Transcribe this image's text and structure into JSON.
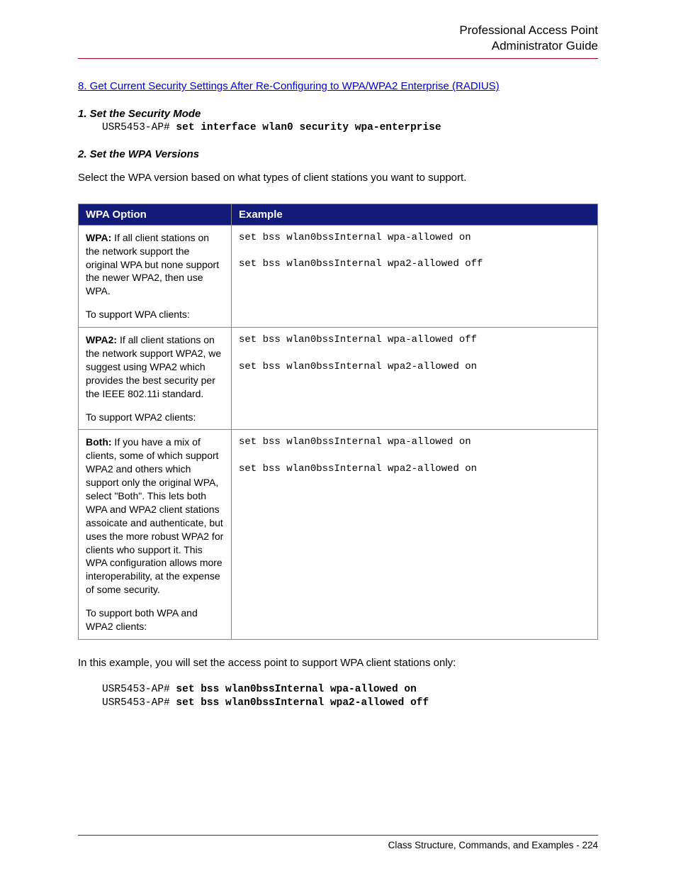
{
  "header": {
    "line1": "Professional Access Point",
    "line2": "Administrator Guide"
  },
  "link_text": "8. Get Current Security Settings After Re-Configuring to WPA/WPA2 Enterprise (RADIUS)",
  "step1": {
    "heading": "1. Set the Security Mode",
    "prompt": "USR5453-AP# ",
    "command": "set interface wlan0 security wpa-enterprise"
  },
  "step2": {
    "heading": "2. Set the WPA Versions"
  },
  "intro": "Select the WPA version based on what types of client stations you want to support.",
  "table": {
    "col1": "WPA Option",
    "col2": "Example",
    "rows": [
      {
        "lead": "WPA:",
        "desc": " If all client stations on the network support the original WPA but none support the newer WPA2, then use WPA.",
        "support": "To support WPA clients:",
        "ex1": "set bss wlan0bssInternal wpa-allowed on",
        "ex2": "set bss wlan0bssInternal wpa2-allowed off"
      },
      {
        "lead": "WPA2:",
        "desc": " If all client stations on the network support WPA2, we suggest using WPA2 which provides the best security per the IEEE 802.11i standard.",
        "support": "To support WPA2 clients:",
        "ex1": "set bss wlan0bssInternal wpa-allowed off",
        "ex2": "set bss wlan0bssInternal wpa2-allowed on"
      },
      {
        "lead": "Both:",
        "desc": " If you have a mix of clients, some of which support WPA2 and others which support only the original WPA, select \"Both\". This lets both WPA and WPA2 client stations assoicate and authenticate, but uses the more robust WPA2 for clients who support it. This WPA configuration allows more interoperability, at the expense of some security.",
        "support": "To support both WPA and WPA2 clients:",
        "ex1": "set bss wlan0bssInternal wpa-allowed on",
        "ex2": "set bss wlan0bssInternal wpa2-allowed on"
      }
    ]
  },
  "after": "In this example, you will set the access point to support WPA client stations only:",
  "example_cmds": {
    "prompt": "USR5453-AP# ",
    "cmd1": "set bss wlan0bssInternal wpa-allowed on",
    "cmd2": "set bss wlan0bssInternal wpa2-allowed off"
  },
  "footer": "Class Structure, Commands, and Examples - 224"
}
